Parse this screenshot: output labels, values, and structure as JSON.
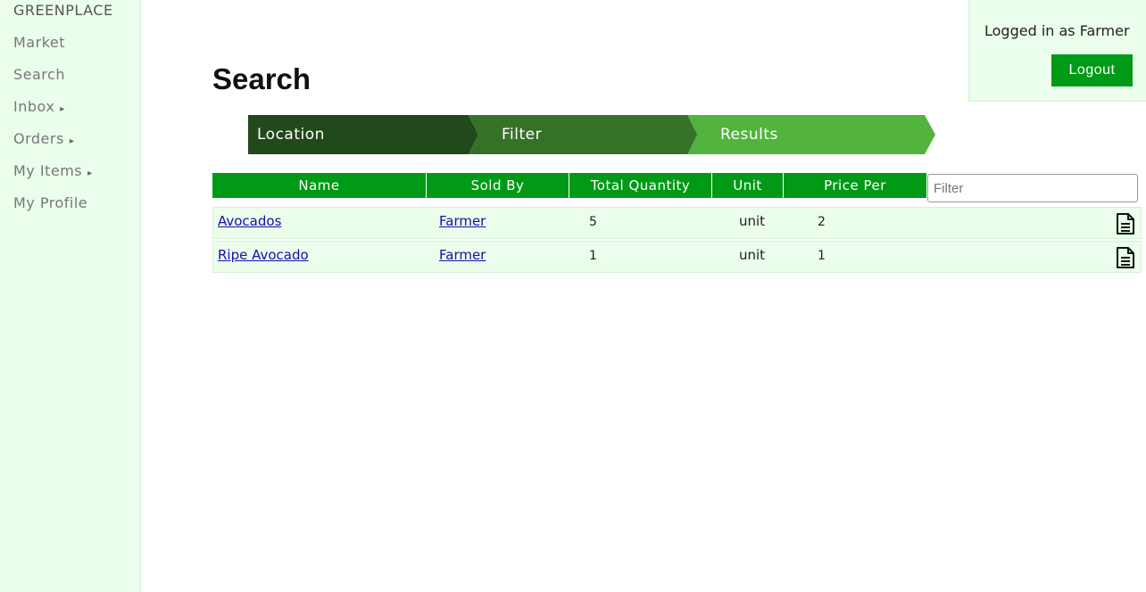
{
  "sidebar": {
    "brand": "GREENPLACE",
    "items": [
      {
        "label": "Market",
        "arrow": ""
      },
      {
        "label": "Search",
        "arrow": ""
      },
      {
        "label": "Inbox",
        "arrow": "▸"
      },
      {
        "label": "Orders",
        "arrow": "▸"
      },
      {
        "label": "My Items",
        "arrow": "▸"
      },
      {
        "label": "My Profile",
        "arrow": ""
      }
    ]
  },
  "account": {
    "status": "Logged in as Farmer",
    "logout_label": "Logout"
  },
  "page": {
    "title": "Search"
  },
  "steps": [
    "Location",
    "Filter",
    "Results"
  ],
  "table": {
    "columns": [
      "Name",
      "Sold By",
      "Total Quantity",
      "Unit",
      "Price Per"
    ],
    "filter_placeholder": "Filter",
    "rows": [
      {
        "name": "Avocados",
        "sold_by": "Farmer",
        "total_quantity": "5",
        "unit": "unit",
        "price_per": "2",
        "icon": "document-icon"
      },
      {
        "name": "Ripe Avocado",
        "sold_by": "Farmer",
        "total_quantity": "1",
        "unit": "unit",
        "price_per": "1",
        "icon": "document-icon"
      }
    ]
  },
  "colors": {
    "accent": "#009a16",
    "sidebar_bg": "#ebfdeb",
    "step_1": "#22491b",
    "step_2": "#367128",
    "step_3": "#52b33f",
    "link": "#1a0dab"
  }
}
